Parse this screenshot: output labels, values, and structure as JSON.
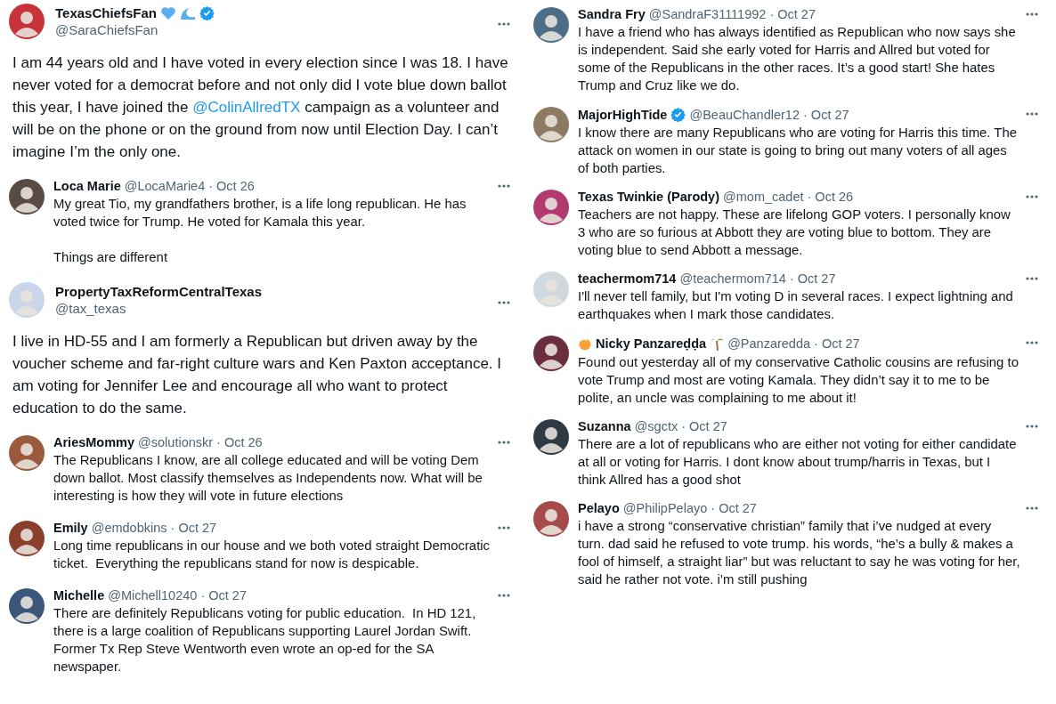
{
  "columns": [
    {
      "posts": [
        {
          "kind": "main",
          "name": "TexasChiefsFan",
          "name_icons": [
            {
              "kind": "heart"
            },
            {
              "kind": "wave"
            }
          ],
          "verified": true,
          "handle": "@SaraChiefsFan",
          "color": "#c8333a",
          "body": [
            {
              "kind": "text",
              "text": "I am 44 years old and I have voted in every election since I was 18. I have never voted for a democrat before and not only did I vote blue down ballot this year, I have joined the "
            },
            {
              "kind": "mention",
              "text": "@ColinAllredTX"
            },
            {
              "kind": "text",
              "text": " campaign as a volunteer and will be on the phone or on the ground from now until Election Day. I can’t imagine I’m the only one."
            }
          ]
        },
        {
          "kind": "reply",
          "name": "Loca Marie",
          "handle": "@LocaMarie4",
          "date": "· Oct 26",
          "color": "#5a4a44",
          "body": [
            {
              "kind": "text",
              "text": "My great Tio, my grandfathers brother, is a life long republican. He has voted twice for Trump. He voted for Kamala this year.\n\nThings are different"
            }
          ]
        },
        {
          "kind": "main",
          "name": "PropertyTaxReformCentralTexas",
          "handle": "@tax_texas",
          "color": "#c9d6ea",
          "body": [
            {
              "kind": "text",
              "text": "I live in HD-55 and I am formerly a Republican but driven away by the voucher scheme and far-right culture wars and Ken Paxton acceptance. I am voting for Jennifer Lee and encourage all who want to protect education to do the same."
            }
          ]
        },
        {
          "kind": "reply",
          "name": "AriesMommy",
          "handle": "@solutionskr",
          "date": "· Oct 26",
          "color": "#9a5a3c",
          "body": [
            {
              "kind": "text",
              "text": "The Republicans I know, are all college educated and will be voting Dem down ballot. Most classify themselves as Independents now. What will be interesting is how they will vote in future elections"
            }
          ]
        },
        {
          "kind": "reply",
          "name": "Emily",
          "handle": "@emdobkins",
          "date": "· Oct 27",
          "color": "#8a3f2c",
          "body": [
            {
              "kind": "text",
              "text": "Long time republicans in our house and we both voted straight Democratic ticket.  Everything the republicans stand for now is despicable."
            }
          ]
        },
        {
          "kind": "reply",
          "name": "Michelle",
          "handle": "@Michell10240",
          "date": "· Oct 27",
          "color": "#3b5678",
          "body": [
            {
              "kind": "text",
              "text": "There are definitely Republicans voting for public education.  In HD 121, there is a large coalition of Republicans supporting Laurel Jordan Swift. Former Tx Rep Steve Wentworth even wrote an op-ed for the SA newspaper."
            }
          ]
        }
      ]
    },
    {
      "posts": [
        {
          "kind": "reply",
          "name": "Sandra Fry",
          "handle": "@SandraF31111992",
          "date": "· Oct 27",
          "color": "#4e6e88",
          "body": [
            {
              "kind": "text",
              "text": "I have a friend who has always identified as Republican who now says she is independent. Said she early voted for Harris and Allred but voted for some of the Republicans in the other races. It’s a good start! She hates Trump and Cruz like we do."
            }
          ]
        },
        {
          "kind": "reply",
          "name": "MajorHighTide",
          "verified": true,
          "handle": "@BeauChandler12",
          "date": "· Oct 27",
          "color": "#8c7a62",
          "body": [
            {
              "kind": "text",
              "text": "I know there are many Republicans who are voting for Harris this time. The attack on women in our state is going to bring out many voters of all ages of both parties."
            }
          ]
        },
        {
          "kind": "reply",
          "name": "Texas Twinkie (Parody)",
          "handle": "@mom_cadet",
          "date": "· Oct 26",
          "color": "#b23a6e",
          "body": [
            {
              "kind": "text",
              "text": "Teachers are not happy. These are lifelong GOP voters. I personally know 3 who are so furious at Abbott they are voting blue to bottom. They are voting blue to send Abbott a message."
            }
          ]
        },
        {
          "kind": "reply",
          "name": "teachermom714",
          "handle": "@teachermom714",
          "date": "· Oct 27",
          "color": "#cfd9de",
          "body": [
            {
              "kind": "text",
              "text": "I'll never tell family, but I'm voting D in several races. I expect lightning and earthquakes when I mark those candidates."
            }
          ]
        },
        {
          "kind": "reply",
          "name": "Nicky Panzareḍḍa",
          "name_icons_before": [
            {
              "kind": "orange"
            }
          ],
          "name_icons": [
            {
              "kind": "palm"
            }
          ],
          "handle": "@Panzaredda",
          "date": "· Oct 27",
          "color": "#6a2e3e",
          "body": [
            {
              "kind": "text",
              "text": "Found out yesterday all of my conservative Catholic cousins are refusing to vote Trump and most are voting Kamala. They didn’t say it to me to be polite, an uncle was complaining to me about it!"
            }
          ]
        },
        {
          "kind": "reply",
          "name": "Suzanna",
          "handle": "@sgctx",
          "date": "· Oct 27",
          "color": "#2f3a44",
          "body": [
            {
              "kind": "text",
              "text": "There are a lot of republicans who are either not voting for either candidate at all or voting for Harris. I dont know about trump/harris in Texas, but I think Allred has a good shot"
            }
          ]
        },
        {
          "kind": "reply",
          "name": "Pelayo",
          "handle": "@PhilipPelayo",
          "date": "· Oct 27",
          "color": "#a64a4a",
          "body": [
            {
              "kind": "text",
              "text": "i have a strong “conservative christian” family that i’ve nudged at every turn. dad said he refused to vote trump. his words, “he’s a bully & makes a fool of himself, a straight liar” but was reluctant to say he was voting for her, said he rather not vote. i’m still pushing"
            }
          ]
        }
      ]
    }
  ]
}
